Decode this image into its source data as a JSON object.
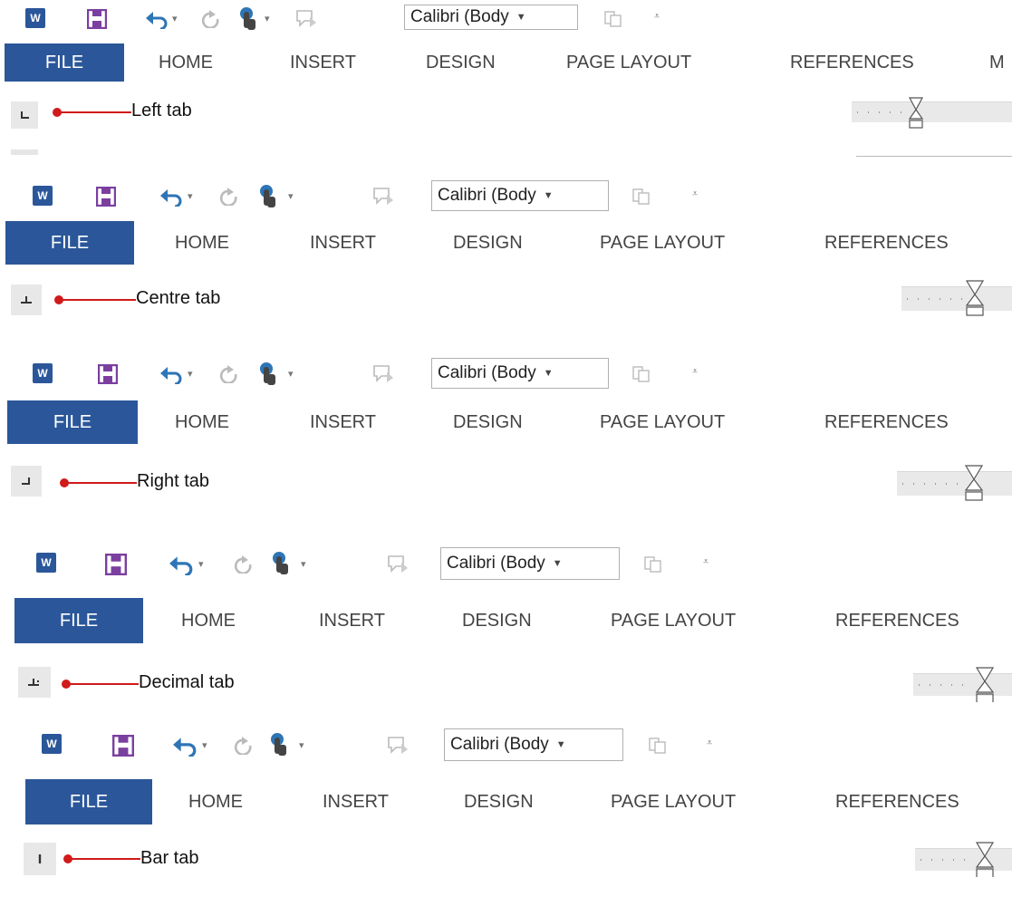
{
  "panels": [
    {
      "font": "Calibri (Body",
      "tabs": [
        "FILE",
        "HOME",
        "INSERT",
        "DESIGN",
        "PAGE LAYOUT",
        "REFERENCES",
        "M"
      ],
      "annotation": "Left tab",
      "tab_stop_icon": "left-tab-icon"
    },
    {
      "font": "Calibri (Body",
      "tabs": [
        "FILE",
        "HOME",
        "INSERT",
        "DESIGN",
        "PAGE LAYOUT",
        "REFERENCES"
      ],
      "annotation": "Centre tab",
      "tab_stop_icon": "center-tab-icon"
    },
    {
      "font": "Calibri (Body",
      "tabs": [
        "FILE",
        "HOME",
        "INSERT",
        "DESIGN",
        "PAGE LAYOUT",
        "REFERENCES"
      ],
      "annotation": "Right tab",
      "tab_stop_icon": "right-tab-icon"
    },
    {
      "font": "Calibri (Body",
      "tabs": [
        "FILE",
        "HOME",
        "INSERT",
        "DESIGN",
        "PAGE LAYOUT",
        "REFERENCES"
      ],
      "annotation": "Decimal tab",
      "tab_stop_icon": "decimal-tab-icon"
    },
    {
      "font": "Calibri (Body",
      "tabs": [
        "FILE",
        "HOME",
        "INSERT",
        "DESIGN",
        "PAGE LAYOUT",
        "REFERENCES"
      ],
      "annotation": "Bar tab",
      "tab_stop_icon": "bar-tab-icon"
    }
  ],
  "colors": {
    "file_tab": "#2b579a",
    "word_logo": "#2b579a",
    "save_icon": "#7b3fa0",
    "undo_icon": "#2e75b6",
    "leader_line": "#d11a1a"
  }
}
